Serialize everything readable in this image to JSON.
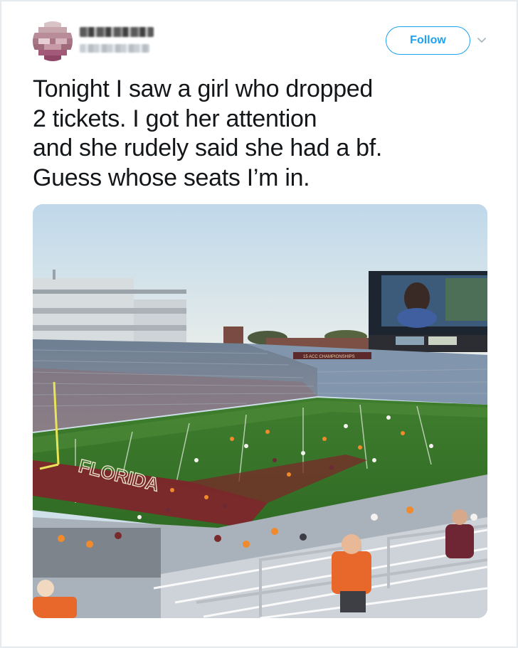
{
  "user": {
    "avatar_icon": "user-avatar-pixelated",
    "name_redacted": true,
    "handle_redacted": true
  },
  "actions": {
    "follow_label": "Follow",
    "more_icon": "chevron-down-icon"
  },
  "tweet": {
    "lines": [
      "Tonight I saw a girl who dropped",
      "2 tickets. I got her attention",
      "and she rudely said she had a bf.",
      "Guess whose seats I’m in."
    ]
  },
  "photo": {
    "subject": "football-stadium-photo",
    "endzone_text": "FLORIDA",
    "banner_text": "15 ACC CHAMPIONSHIPS"
  },
  "colors": {
    "accent": "#1da1f2",
    "text": "#14171a",
    "border": "#e1e8ed"
  }
}
